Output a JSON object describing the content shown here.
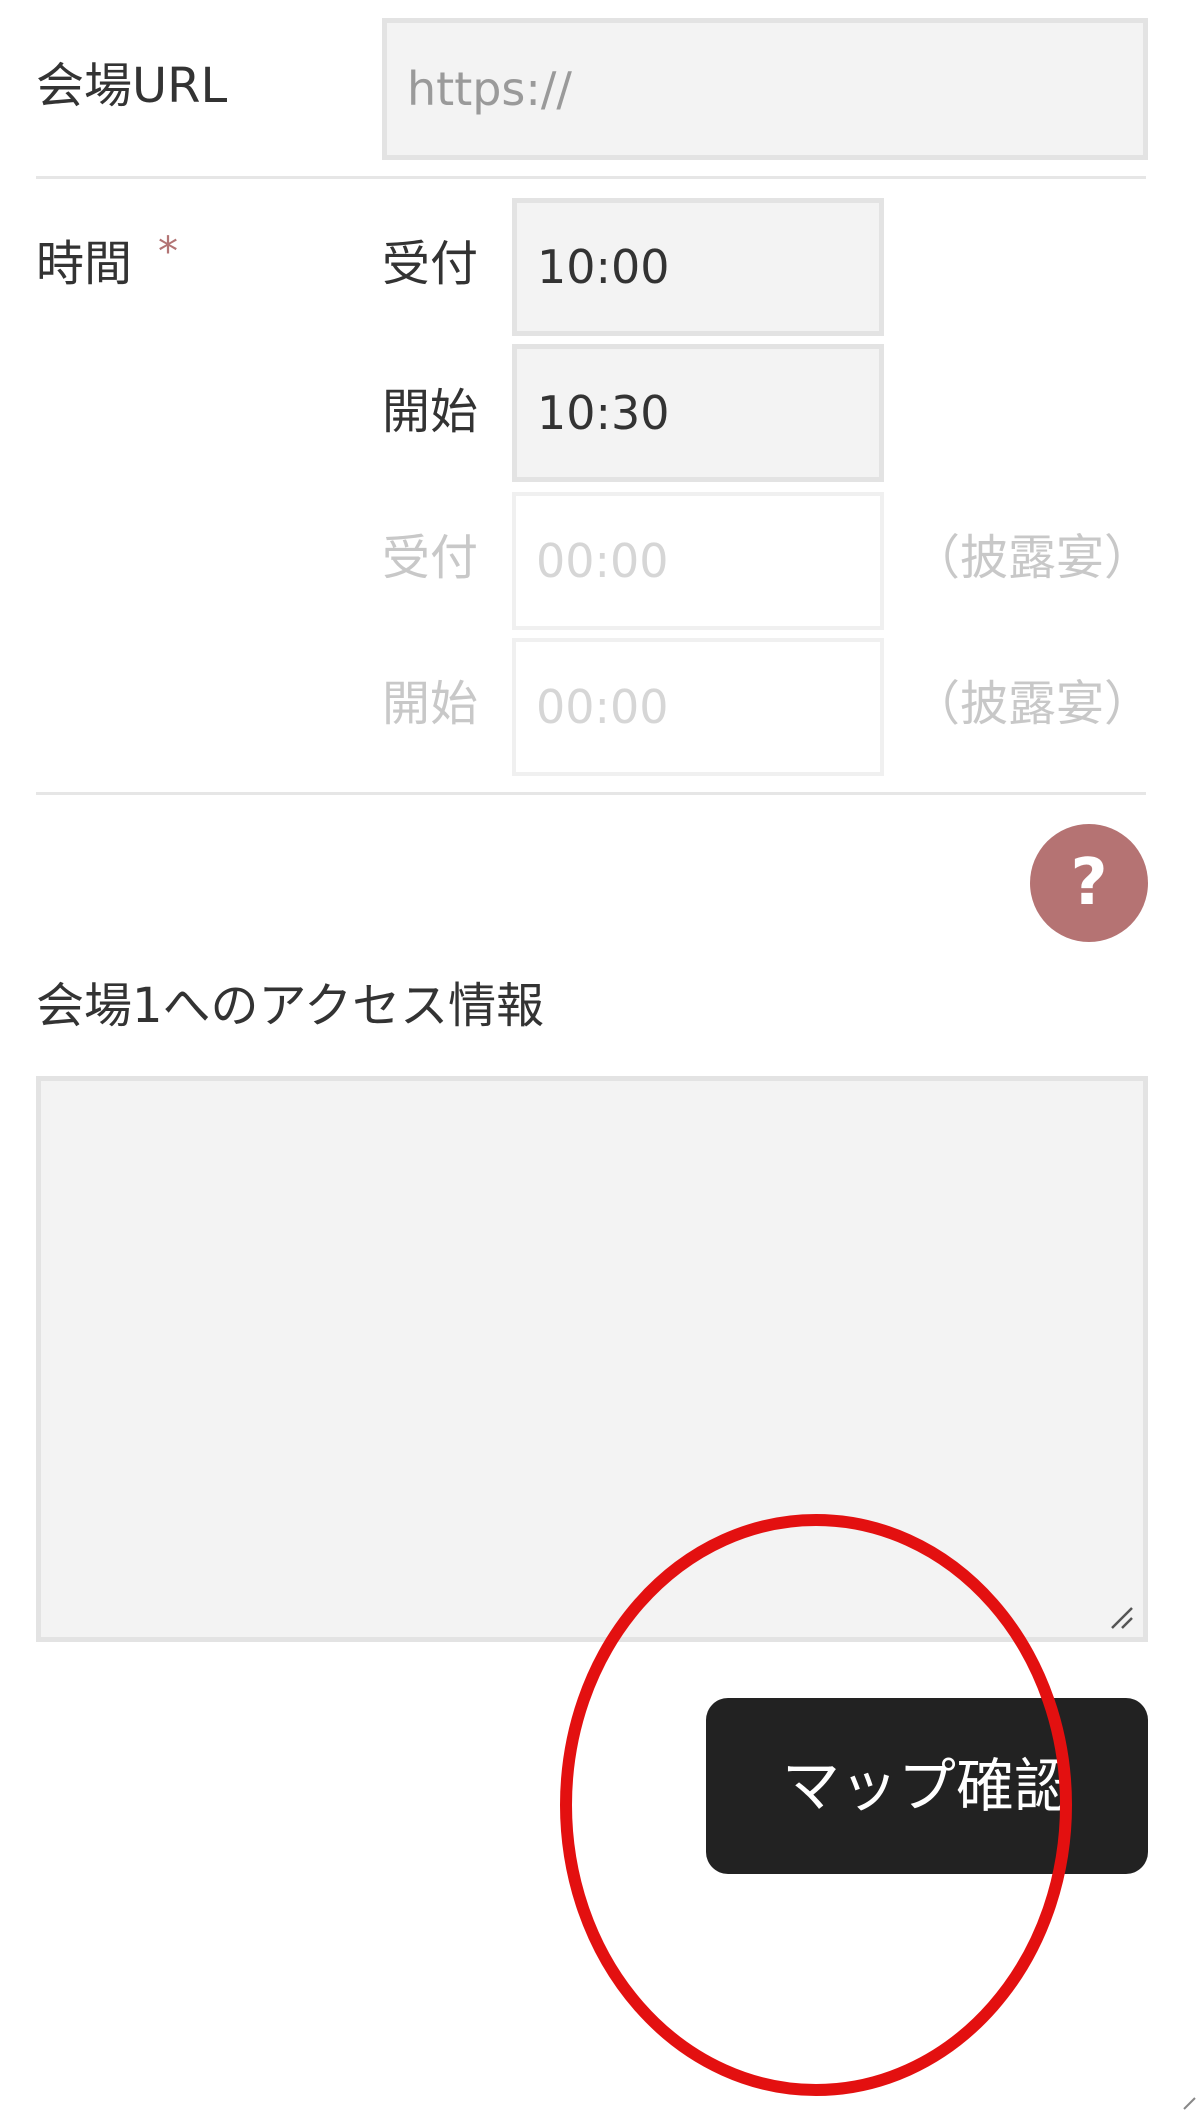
{
  "venue_url": {
    "label": "会場URL",
    "placeholder": "https://",
    "value": ""
  },
  "time": {
    "label": "時間",
    "required_mark": "*",
    "reception": {
      "label": "受付",
      "value": "10:00"
    },
    "start": {
      "label": "開始",
      "value": "10:30"
    },
    "reception_party": {
      "label": "受付",
      "placeholder": "00:00",
      "note": "（披露宴）"
    },
    "start_party": {
      "label": "開始",
      "placeholder": "00:00",
      "note": "（披露宴）"
    }
  },
  "help": {
    "icon": "question-icon",
    "glyph": "?"
  },
  "access_info": {
    "label": "会場1へのアクセス情報",
    "value": ""
  },
  "map_button": {
    "label": "マップ確認"
  },
  "colors": {
    "accent": "#b57373",
    "button_bg": "#222222",
    "highlight": "#e31010"
  }
}
